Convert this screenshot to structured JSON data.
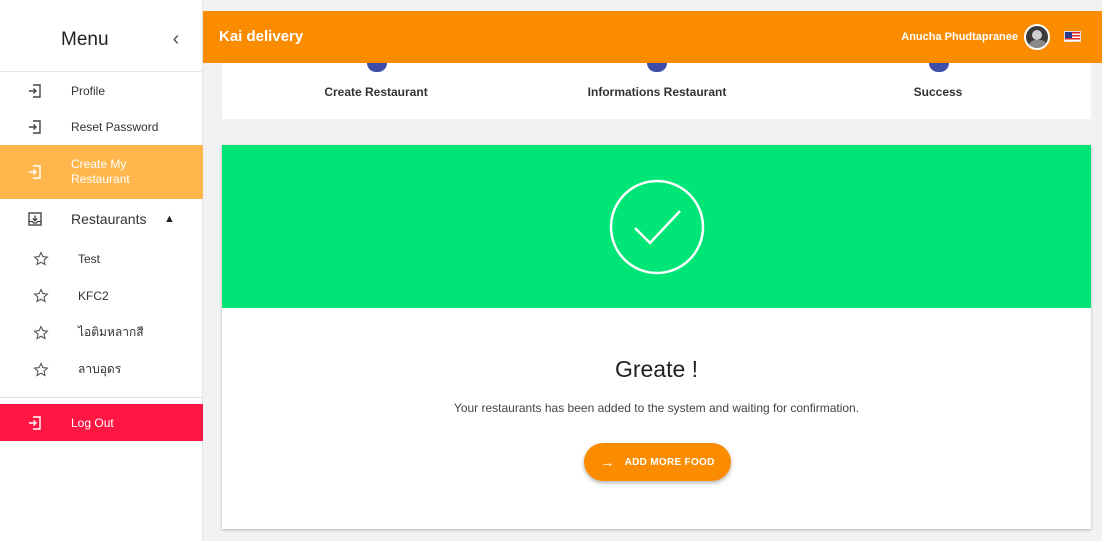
{
  "sidebar": {
    "title": "Menu",
    "collapse_icon": "chevron-left-icon",
    "items": [
      {
        "label": "Profile",
        "icon": "login-icon"
      },
      {
        "label": "Reset Password",
        "icon": "login-icon"
      },
      {
        "label": "Create My Restaurant",
        "icon": "login-icon",
        "active": true
      }
    ],
    "restaurants": {
      "label": "Restaurants",
      "icon": "inbox-icon",
      "expanded": true,
      "items": [
        {
          "label": "Test",
          "icon": "star-icon"
        },
        {
          "label": "KFC2",
          "icon": "star-icon"
        },
        {
          "label": "ไอติมหลากสี",
          "icon": "star-icon"
        },
        {
          "label": "ลาบอุดร",
          "icon": "star-icon"
        }
      ]
    },
    "logout": {
      "label": "Log Out",
      "icon": "login-icon"
    }
  },
  "topbar": {
    "app_name": "Kai delivery",
    "user_name": "Anucha Phudtapranee",
    "language_flag": "us-flag-icon"
  },
  "stepper": {
    "steps": [
      {
        "label": "Create Restaurant"
      },
      {
        "label": "Informations Restaurant"
      },
      {
        "label": "Success"
      }
    ]
  },
  "success": {
    "title": "Greate !",
    "message": "Your restaurants has been added to the system and waiting for confirmation.",
    "button_label": "ADD MORE FOOD",
    "button_icon": "arrow-right-icon"
  },
  "colors": {
    "primary": "#fb8c00",
    "active_item": "#ffb74d",
    "logout": "#ff1744",
    "success_banner": "#00e676",
    "step_dot": "#3f4ea8"
  }
}
